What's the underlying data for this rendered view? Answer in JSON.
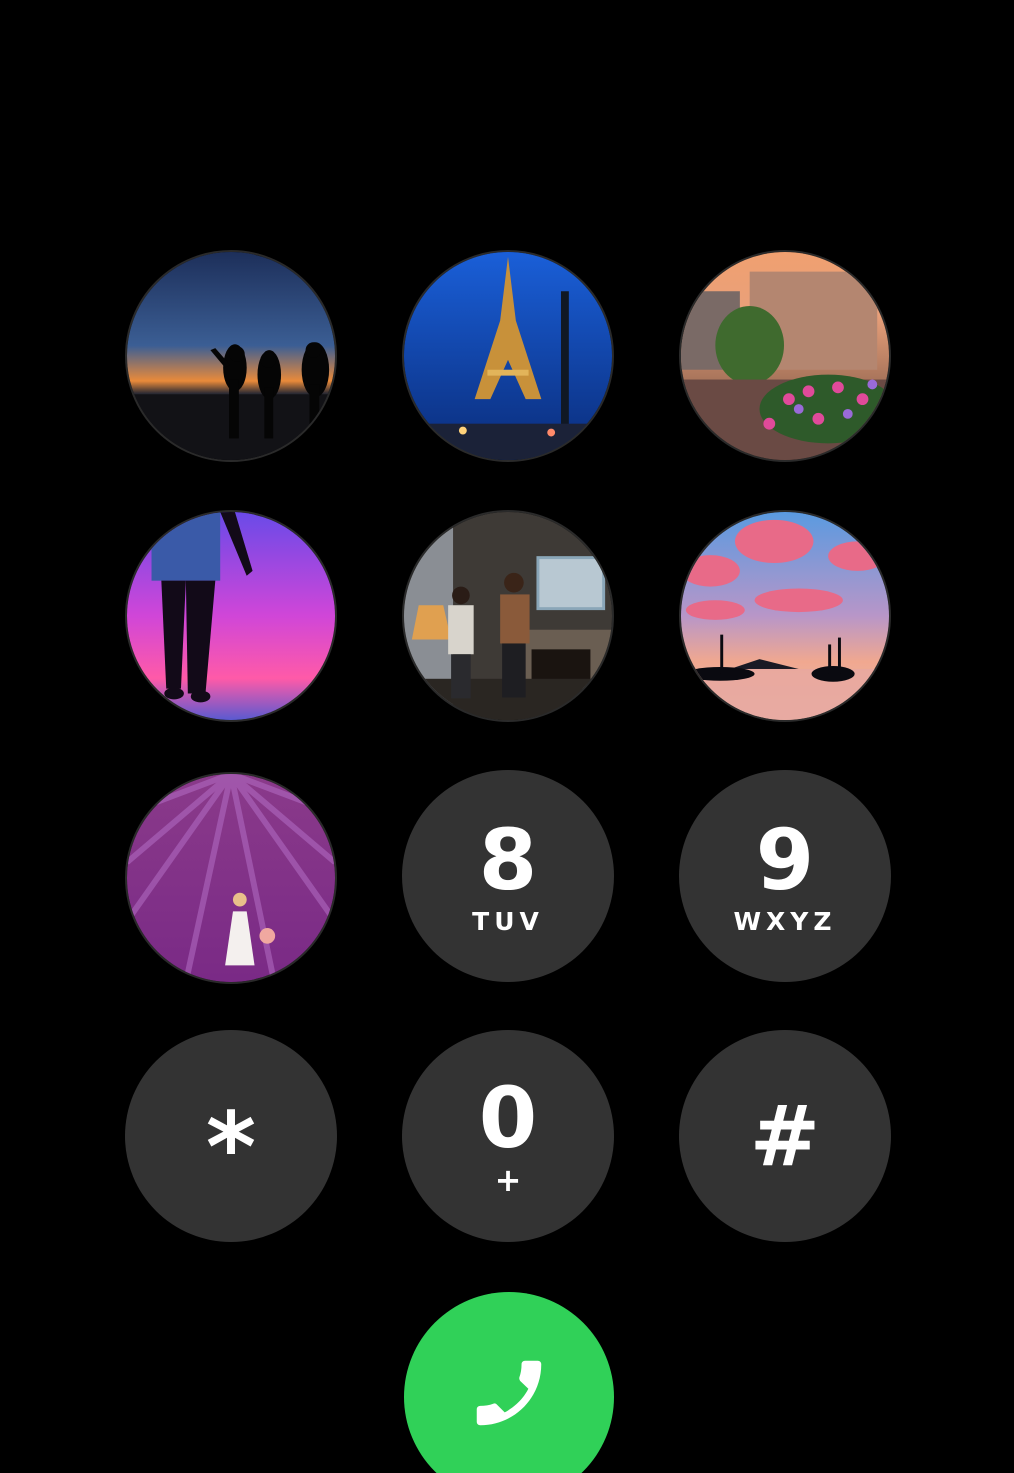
{
  "keypad": {
    "photo_keys": [
      {
        "icon": "beach-sunset-silhouettes-photo"
      },
      {
        "icon": "eiffel-tower-night-photo"
      },
      {
        "icon": "canal-flowers-sunset-photo"
      },
      {
        "icon": "legs-jumping-purple-sky-photo"
      },
      {
        "icon": "couple-living-room-photo"
      },
      {
        "icon": "tropical-island-sunset-photo"
      },
      {
        "icon": "lavender-field-woman-photo"
      }
    ],
    "keys": {
      "eight": {
        "digit": "8",
        "letters": "TUV"
      },
      "nine": {
        "digit": "9",
        "letters": "WXYZ"
      },
      "star": {
        "digit": "*"
      },
      "zero": {
        "digit": "0",
        "letters": "+"
      },
      "hash": {
        "digit": "#"
      }
    },
    "call_button": {
      "icon": "phone-icon"
    }
  },
  "colors": {
    "background": "#000000",
    "key": "#333333",
    "call": "#30d158"
  }
}
